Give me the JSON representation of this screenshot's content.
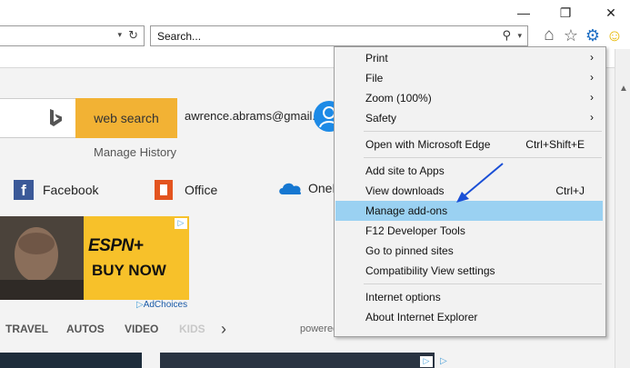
{
  "window": {
    "minimize": "—",
    "restore": "❐",
    "close": "✕"
  },
  "addressbar": {
    "dropdown": "▾",
    "refresh": "↻"
  },
  "searchbar": {
    "placeholder": "Search...",
    "search_icon": "⚲",
    "dropdown": "▾"
  },
  "toolbar": {
    "home": "⌂",
    "favorites": "☆",
    "tools": "⚙",
    "feedback": "☺"
  },
  "page": {
    "bing_button": "web search",
    "email": "awrence.abrams@gmail.c...",
    "manage_history": "Manage History",
    "quicklinks": [
      "Facebook",
      "Office",
      "OneD"
    ],
    "ad": {
      "brand": "ESPN+",
      "cta": "BUY NOW",
      "adchoices": "AdChoices",
      "tag": "▷"
    },
    "categories": [
      "TRAVEL",
      "AUTOS",
      "VIDEO",
      "KIDS"
    ],
    "next": "›",
    "powered": "powered by Microsoft News"
  },
  "menu": {
    "items": [
      {
        "label": "Print",
        "submenu": true
      },
      {
        "label": "File",
        "submenu": true
      },
      {
        "label": "Zoom (100%)",
        "submenu": true
      },
      {
        "label": "Safety",
        "submenu": true
      },
      {
        "label": "Open with Microsoft Edge",
        "shortcut": "Ctrl+Shift+E"
      },
      {
        "label": "Add site to Apps"
      },
      {
        "label": "View downloads",
        "shortcut": "Ctrl+J"
      },
      {
        "label": "Manage add-ons",
        "highlighted": true
      },
      {
        "label": "F12 Developer Tools"
      },
      {
        "label": "Go to pinned sites"
      },
      {
        "label": "Compatibility View settings"
      },
      {
        "label": "Internet options"
      },
      {
        "label": "About Internet Explorer"
      }
    ],
    "submenu_arrow": "›"
  },
  "colors": {
    "menu_highlight": "#9ad1f2",
    "annotation_arrow": "#1a4fd6",
    "bing_button": "#f2b234",
    "tools_icon": "#1f6fc4",
    "feedback_icon": "#f2c61f"
  }
}
